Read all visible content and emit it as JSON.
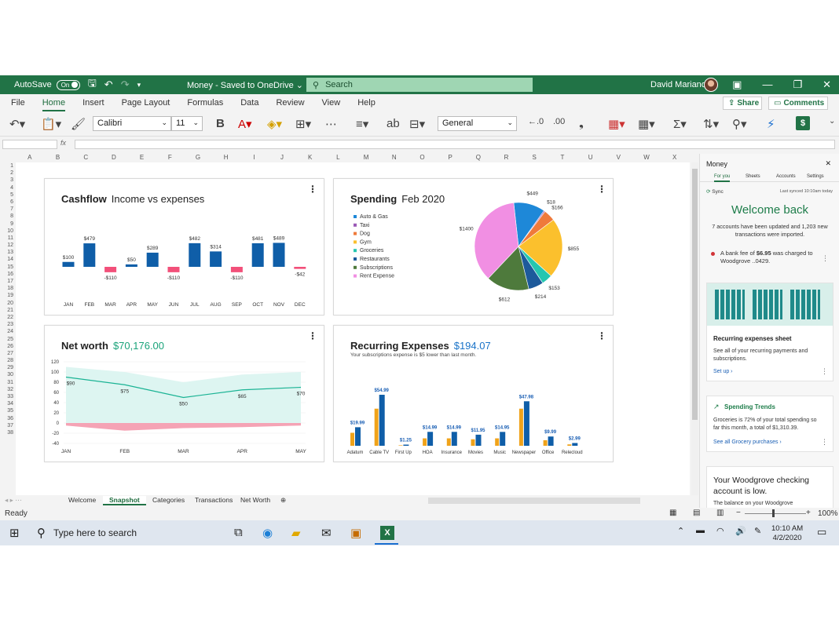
{
  "titlebar": {
    "autosave_label": "AutoSave",
    "autosave_state": "On",
    "doc_title": "Money - Saved to OneDrive ⌄",
    "search_placeholder": "Search",
    "user_name": "David Mariano"
  },
  "ribbon": {
    "tabs": [
      "File",
      "Home",
      "Insert",
      "Page Layout",
      "Formulas",
      "Data",
      "Review",
      "View",
      "Help"
    ],
    "active_tab": "Home",
    "share_label": "Share",
    "comments_label": "Comments",
    "font_name": "Calibri",
    "font_size": "11",
    "number_format": "General"
  },
  "grid": {
    "columns": [
      "A",
      "B",
      "C",
      "D",
      "E",
      "F",
      "G",
      "H",
      "I",
      "J",
      "K",
      "L",
      "M",
      "N",
      "O",
      "P",
      "Q",
      "R",
      "S",
      "T",
      "U",
      "V",
      "W",
      "X"
    ],
    "rows": [
      "1",
      "2",
      "3",
      "4",
      "5",
      "6",
      "7",
      "8",
      "9",
      "10",
      "11",
      "12",
      "13",
      "14",
      "15",
      "16",
      "17",
      "18",
      "19",
      "20",
      "21",
      "22",
      "23",
      "24",
      "25",
      "26",
      "27",
      "28",
      "29",
      "30",
      "31",
      "32",
      "33",
      "34",
      "35",
      "36",
      "37",
      "38"
    ]
  },
  "cashflow": {
    "title": "Cashflow",
    "subtitle": "Income vs expenses",
    "colors": {
      "positive": "#0f5ea8",
      "negative": "#f2507a"
    },
    "chart_data": {
      "type": "bar",
      "categories": [
        "JAN",
        "FEB",
        "MAR",
        "APR",
        "MAY",
        "JUN",
        "JUL",
        "AUG",
        "SEP",
        "OCT",
        "NOV",
        "DEC"
      ],
      "values": [
        100,
        479,
        -110,
        50,
        289,
        -110,
        482,
        314,
        -110,
        481,
        489,
        -42
      ],
      "labels": [
        "$100",
        "$479",
        "-$110",
        "$50",
        "$289",
        "-$110",
        "$482",
        "$314",
        "-$110",
        "$481",
        "$489",
        "-$42"
      ]
    }
  },
  "spending": {
    "title": "Spending",
    "subtitle": "Feb 2020",
    "chart_data": {
      "type": "pie",
      "legend": [
        "Auto & Gas",
        "Taxi",
        "Dog",
        "Gym",
        "Groceries",
        "Restaurants",
        "Subscriptions",
        "Rent Expense"
      ],
      "slices": [
        {
          "name": "Auto & Gas",
          "value": 449,
          "label": "$449",
          "color": "#1e88d8"
        },
        {
          "name": "Taxi",
          "value": 18,
          "label": "$18",
          "color": "#9b59b6"
        },
        {
          "name": "Dog",
          "value": 166,
          "label": "$166",
          "color": "#ef7a3b"
        },
        {
          "name": "Gym",
          "value": 855,
          "label": "$855",
          "color": "#fbc02d"
        },
        {
          "name": "Groceries",
          "value": 153,
          "label": "$153",
          "color": "#26c6b0"
        },
        {
          "name": "Restaurants",
          "value": 214,
          "label": "$214",
          "color": "#1d5a9b"
        },
        {
          "name": "Subscriptions",
          "value": 612,
          "label": "$612",
          "color": "#4e7a3c"
        },
        {
          "name": "Rent Expense",
          "value": 1400,
          "label": "$1400",
          "color": "#f18fe3"
        }
      ]
    }
  },
  "networth": {
    "title": "Net worth",
    "value": "$70,176.00",
    "chart_data": {
      "type": "area",
      "x": [
        "JAN",
        "FEB",
        "MAR",
        "APR",
        "MAY"
      ],
      "y_ticks": [
        "120",
        "100",
        "80",
        "60",
        "40",
        "20",
        "0",
        "-20",
        "-40"
      ],
      "ylim": [
        -40,
        120
      ],
      "line": [
        90,
        75,
        50,
        65,
        70
      ],
      "line_labels": [
        "$90",
        "$75",
        "$50",
        "$65",
        "$70"
      ],
      "band_upper": [
        110,
        100,
        80,
        95,
        100
      ],
      "neg_band": [
        -5,
        -15,
        -10,
        -8,
        -5
      ],
      "colors": {
        "line": "#1ab394",
        "band": "#ddf5f1",
        "neg": "#f5a3b5"
      }
    }
  },
  "recurring": {
    "title": "Recurring Expenses",
    "value": "$194.07",
    "note": "Your subscriptions expense is $5 lower than last month.",
    "chart_data": {
      "type": "bar",
      "categories": [
        "Adatum",
        "Cable TV",
        "First Up",
        "HOA",
        "Insurance",
        "Movies",
        "Music",
        "Newspaper",
        "Office",
        "Relecloud"
      ],
      "series": [
        {
          "values": [
            14,
            40,
            0.5,
            8,
            8,
            7,
            8,
            40,
            6,
            1.5
          ],
          "color": "#f0a31a"
        },
        {
          "values": [
            19.99,
            54.99,
            1.25,
            14.99,
            14.99,
            11.95,
            14.95,
            47.98,
            9.99,
            2.99
          ],
          "color": "#0f5ea8"
        }
      ],
      "labels": [
        "$19.99",
        "$54.99",
        "$1.25",
        "$14.99",
        "$14.99",
        "$11.95",
        "$14.95",
        "$47.98",
        "$9.99",
        "$2.99"
      ]
    }
  },
  "sheet_tabs": [
    "Welcome",
    "Snapshot",
    "Categories",
    "Transactions",
    "Net Worth"
  ],
  "active_sheet": "Snapshot",
  "status": {
    "ready": "Ready",
    "zoom": "100%"
  },
  "pane": {
    "title": "Money",
    "tabs": [
      "For you",
      "Sheets",
      "Accounts",
      "Settings"
    ],
    "sync": "Sync",
    "last_synced": "Last synced 10:10am today",
    "welcome": "Welcome back",
    "welcome_text": "7 accounts have been updated and 1,203 new transactions were imported.",
    "fee_alert": {
      "prefix": "A bank fee of ",
      "amount": "$6.95",
      "suffix": " was charged to Woodgrove ..0429."
    },
    "recurring_card": {
      "title": "Recurring expenses sheet",
      "text": "See all of your recurring payments and subscriptions.",
      "link": "Set up ›"
    },
    "trends_card": {
      "title": "Spending Trends",
      "text": "Groceries is 72% of your total spending so far this month, a total of $1,310.39.",
      "link": "See all Grocery purchases ›"
    },
    "low_card": {
      "title": "Your Woodgrove checking account is low.",
      "text": "The balance on your Woodgrove"
    }
  },
  "taskbar": {
    "search_placeholder": "Type here to search",
    "time": "10:10 AM",
    "date": "4/2/2020"
  }
}
